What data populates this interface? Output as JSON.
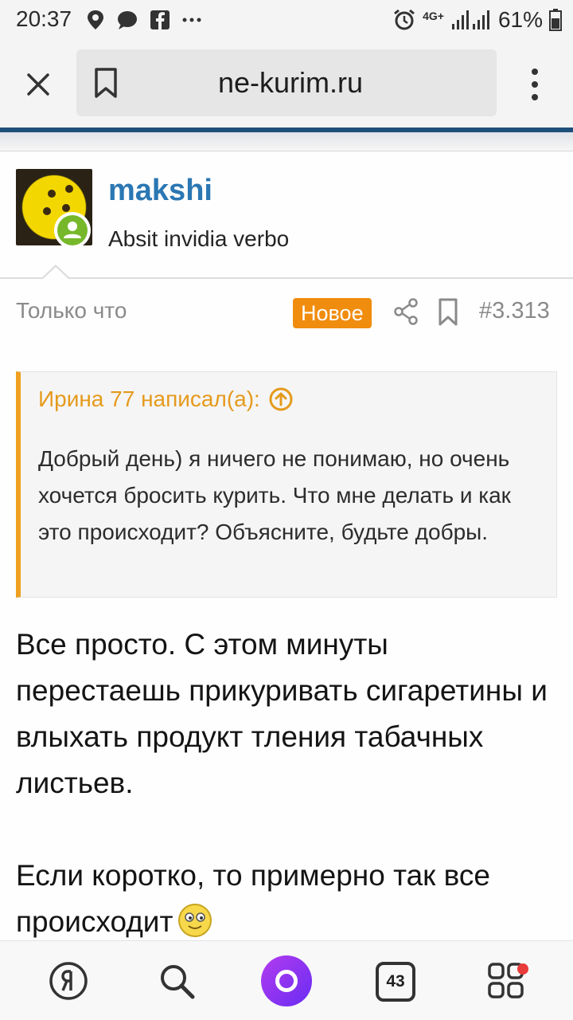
{
  "status_bar": {
    "time": "20:37",
    "battery_percent": "61%",
    "network": "4G+",
    "icons": [
      "location-icon",
      "chat-icon",
      "facebook-icon",
      "more-icon",
      "alarm-icon",
      "signal-icon",
      "battery-icon"
    ]
  },
  "browser": {
    "url": "ne-kurim.ru",
    "icons": [
      "close-icon",
      "bookmark-icon",
      "menu-icon"
    ]
  },
  "post": {
    "username": "makshi",
    "user_title": "Absit invidia verbo",
    "time": "Только что",
    "new_badge": "Новое",
    "post_number": "#3.313",
    "quote": {
      "author_line": "Ирина 77 написал(а):",
      "text": "Добрый день) я ничего не понимаю, но очень хочется бросить курить. Что мне делать и как это происходит? Объясните, будьте добры."
    },
    "message": [
      "Все просто. С этом минуты перестаешь прикуривать сигаретины и влыхать продукт тления табачных листьев.",
      "Если коротко, то примерно так все происходит"
    ]
  },
  "bottom_nav": {
    "tabs_count": "43",
    "items": [
      "yandex-icon",
      "search-icon",
      "alice-icon",
      "tabs-icon",
      "services-icon"
    ]
  },
  "colors": {
    "username": "#2a77b3",
    "badge_new": "#f08c0e",
    "quote_accent": "#f0a020",
    "online": "#76b82a",
    "alice": "#8a33f2"
  }
}
